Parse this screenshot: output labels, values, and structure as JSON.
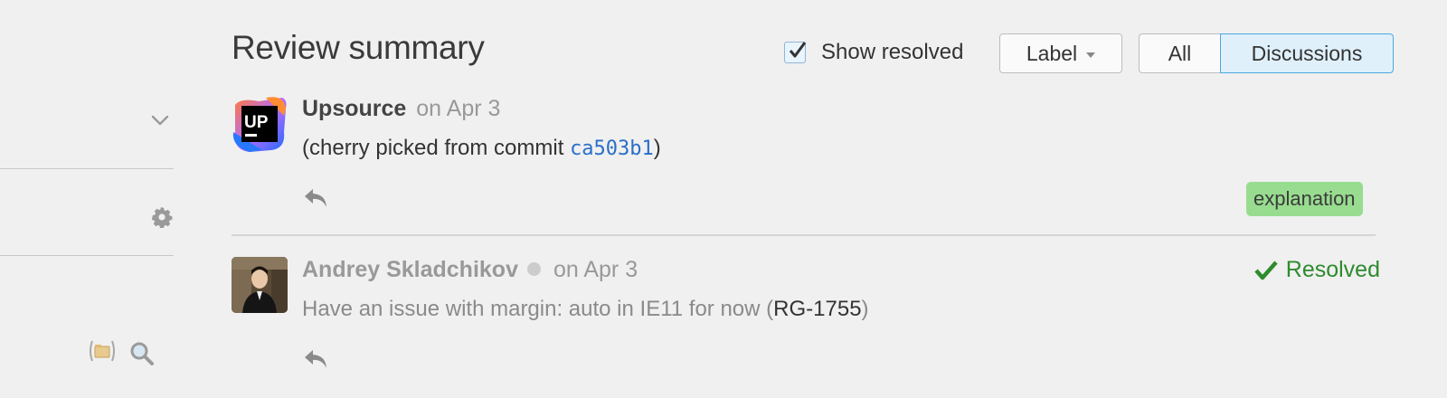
{
  "review": {
    "title": "Review summary",
    "show_resolved_label": "Show resolved",
    "show_resolved_checked": true,
    "label_button": "Label",
    "filter_tabs": [
      {
        "label": "All",
        "selected": false
      },
      {
        "label": "Discussions",
        "selected": true
      }
    ]
  },
  "comments": [
    {
      "author": "Upsource",
      "date": "on Apr 3",
      "avatar_text": "UP",
      "body_prefix": "(cherry picked from commit ",
      "commit": "ca503b1",
      "body_suffix": ")",
      "tag": "explanation"
    },
    {
      "author": "Andrey Skladchikov",
      "date": "on Apr 3",
      "status": "Resolved",
      "body_prefix": "Have an issue with margin: auto in IE11 for now (",
      "issue": "RG-1755",
      "body_suffix": ")"
    }
  ],
  "icons": {
    "sidebar": [
      "chevron-down-icon",
      "gear-icon",
      "brackets-folder-icon",
      "search-icon"
    ],
    "comments": [
      "reply-icon",
      "checkmark-icon"
    ]
  },
  "colors": {
    "accent_blue": "#4aa8e0",
    "commit_link": "#2a6fc9",
    "tag_green": "#98dc8f",
    "resolved_green": "#2e8b2e"
  }
}
